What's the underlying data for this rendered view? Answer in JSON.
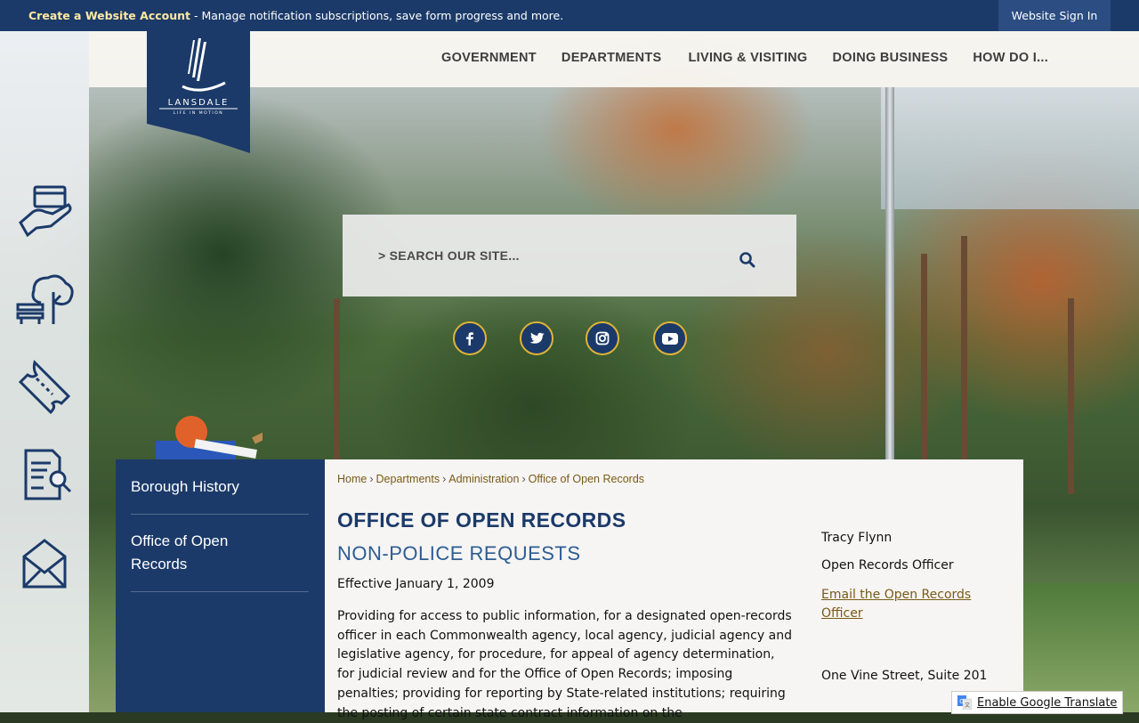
{
  "topbar": {
    "create_account": "Create a Website Account",
    "message": " - Manage notification subscriptions, save form progress and more.",
    "sign_in": "Website Sign In"
  },
  "logo": {
    "name": "LANSDALE",
    "tagline": "LIFE IN MOTION"
  },
  "nav": {
    "items": [
      "GOVERNMENT",
      "DEPARTMENTS",
      "LIVING & VISITING",
      "DOING BUSINESS",
      "HOW DO I..."
    ]
  },
  "rail": {
    "icons": [
      "pay-bill-icon",
      "parks-icon",
      "tickets-icon",
      "records-search-icon",
      "notify-me-icon"
    ]
  },
  "search": {
    "placeholder": "> SEARCH OUR SITE..."
  },
  "social": [
    "facebook-icon",
    "twitter-icon",
    "instagram-icon",
    "youtube-icon"
  ],
  "sidenav": {
    "items": [
      "Borough History",
      "Office of Open Records"
    ]
  },
  "breadcrumb": {
    "items": [
      "Home",
      "Departments",
      "Administration",
      "Office of Open Records"
    ]
  },
  "content": {
    "title": "OFFICE OF OPEN RECORDS",
    "subtitle": "NON-POLICE REQUESTS",
    "effective": "Effective January 1, 2009",
    "paragraph": "Providing for access to public information, for a designated open-records officer in each Commonwealth agency, local agency, judicial agency and legislative agency, for procedure, for appeal of agency determination, for judicial review and for the Office of Open Records; imposing penalties; providing for reporting by State-related institutions; requiring the posting of certain state contract information on the"
  },
  "contact": {
    "name": "Tracy Flynn",
    "role": "Open Records Officer",
    "email_link": "Email the Open Records Officer",
    "address": "One Vine Street, Suite 201"
  },
  "translate": {
    "label": "Enable Google Translate"
  },
  "colors": {
    "navy": "#1b3a69",
    "gold": "#e0b437",
    "link_brown": "#7a5a16",
    "subtitle_blue": "#2d5c93"
  }
}
